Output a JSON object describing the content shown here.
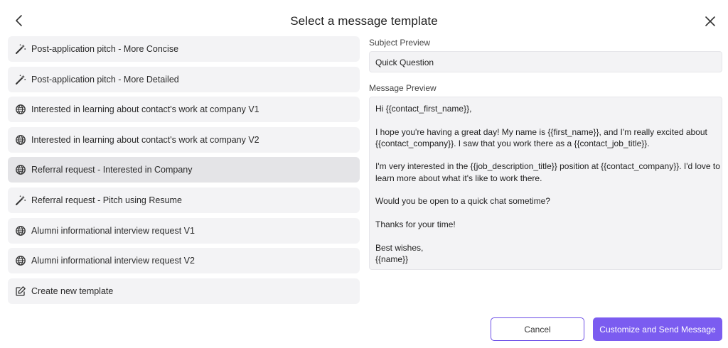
{
  "header": {
    "title": "Select a message template",
    "back_icon": "chevron-left-icon",
    "close_icon": "close-icon"
  },
  "templates": [
    {
      "label": "Post-application pitch - More Concise",
      "icon": "magic-wand-icon",
      "selected": false
    },
    {
      "label": "Post-application pitch - More Detailed",
      "icon": "magic-wand-icon",
      "selected": false
    },
    {
      "label": "Interested in learning about contact's work at company V1",
      "icon": "globe-icon",
      "selected": false
    },
    {
      "label": "Interested in learning about contact's work at company V2",
      "icon": "globe-icon",
      "selected": false
    },
    {
      "label": "Referral request - Interested in Company",
      "icon": "globe-icon",
      "selected": true
    },
    {
      "label": "Referral request - Pitch using Resume",
      "icon": "magic-wand-icon",
      "selected": false
    },
    {
      "label": "Alumni informational interview request V1",
      "icon": "globe-icon",
      "selected": false
    },
    {
      "label": "Alumni informational interview request V2",
      "icon": "globe-icon",
      "selected": false
    },
    {
      "label": "Create new template",
      "icon": "edit-icon",
      "selected": false
    }
  ],
  "preview": {
    "subject_label": "Subject Preview",
    "subject": "Quick Question",
    "message_label": "Message Preview",
    "greeting": "Hi {{contact_first_name}},",
    "para1_line1": "I hope you're having a great day! My name is {{first_name}}, and I'm really excited about",
    "para1_line2": "{{contact_company}}. I saw that you work there as a {{contact_job_title}}.",
    "para2_line1": "I'm very interested in the {{job_description_title}} position at {{contact_company}}. I'd love to",
    "para2_line2": "learn more about what it's like to work there.",
    "para3": "Would you be open to a quick chat sometime?",
    "para4": "Thanks for your time!",
    "signoff": "Best wishes,",
    "signature": "{{name}}"
  },
  "actions": {
    "cancel_label": "Cancel",
    "primary_label": "Customize and Send Message"
  },
  "colors": {
    "accent": "#7b5cf0",
    "accent_border": "#6b4de6",
    "item_bg": "#f3f3f5",
    "item_selected_bg": "#e4e4e7"
  }
}
